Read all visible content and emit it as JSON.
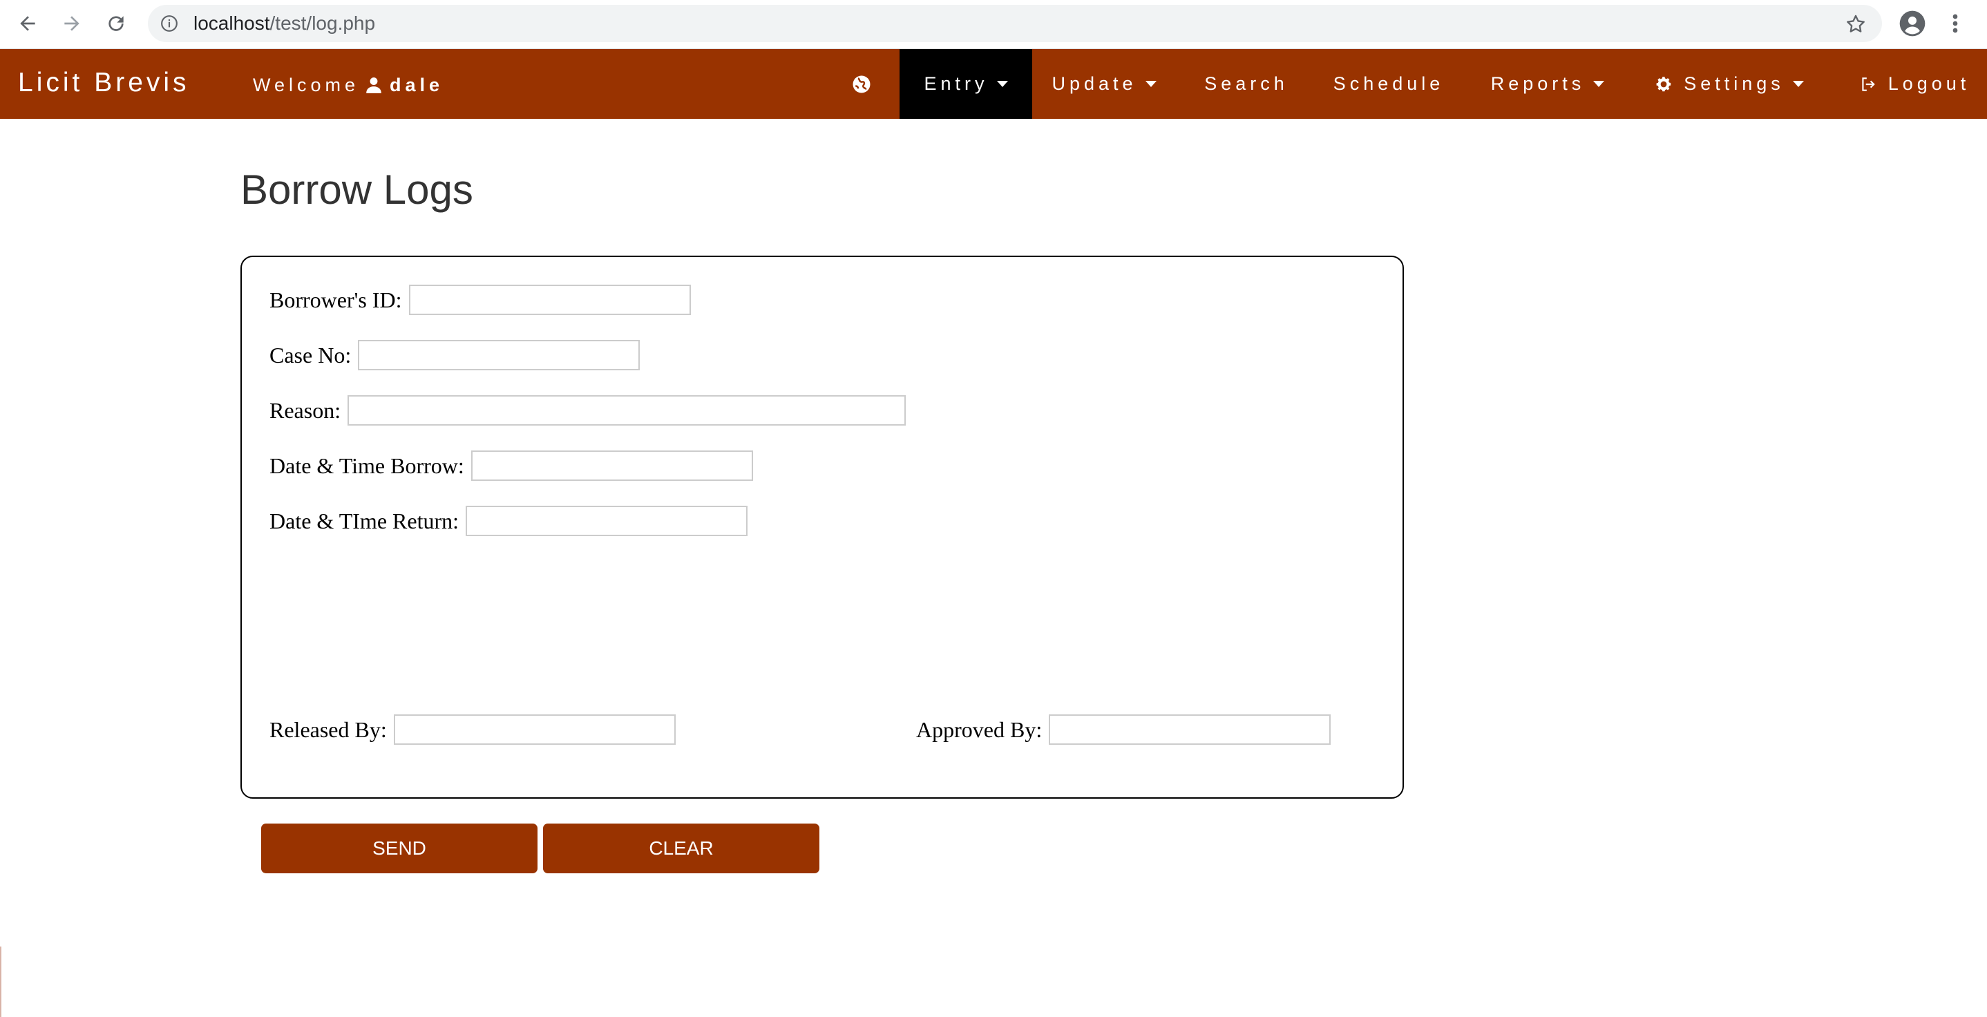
{
  "browser": {
    "url_host": "localhost",
    "url_path": "/test/log.php"
  },
  "navbar": {
    "brand": "Licit Brevis",
    "welcome_label": "Welcome",
    "username": "dale",
    "items": [
      {
        "label": "Entry",
        "dropdown": true,
        "active": true
      },
      {
        "label": "Update",
        "dropdown": true
      },
      {
        "label": "Search"
      },
      {
        "label": "Schedule"
      },
      {
        "label": "Reports",
        "dropdown": true
      },
      {
        "label": "Settings",
        "dropdown": true,
        "icon": "gear-icon"
      },
      {
        "label": "Logout",
        "icon": "logout-icon"
      }
    ]
  },
  "page": {
    "title": "Borrow Logs"
  },
  "form": {
    "borrower_id": {
      "label": "Borrower's ID:",
      "value": ""
    },
    "case_no": {
      "label": "Case No:",
      "value": ""
    },
    "reason": {
      "label": "Reason:",
      "value": ""
    },
    "date_borrow": {
      "label": "Date & Time Borrow:",
      "value": ""
    },
    "date_return": {
      "label": "Date & TIme Return:",
      "value": ""
    },
    "released_by": {
      "label": "Released By:",
      "value": ""
    },
    "approved_by": {
      "label": "Approved By:",
      "value": ""
    }
  },
  "buttons": {
    "send": "SEND",
    "clear": "CLEAR"
  },
  "colors": {
    "brand": "#993300",
    "active_nav": "#000000"
  }
}
